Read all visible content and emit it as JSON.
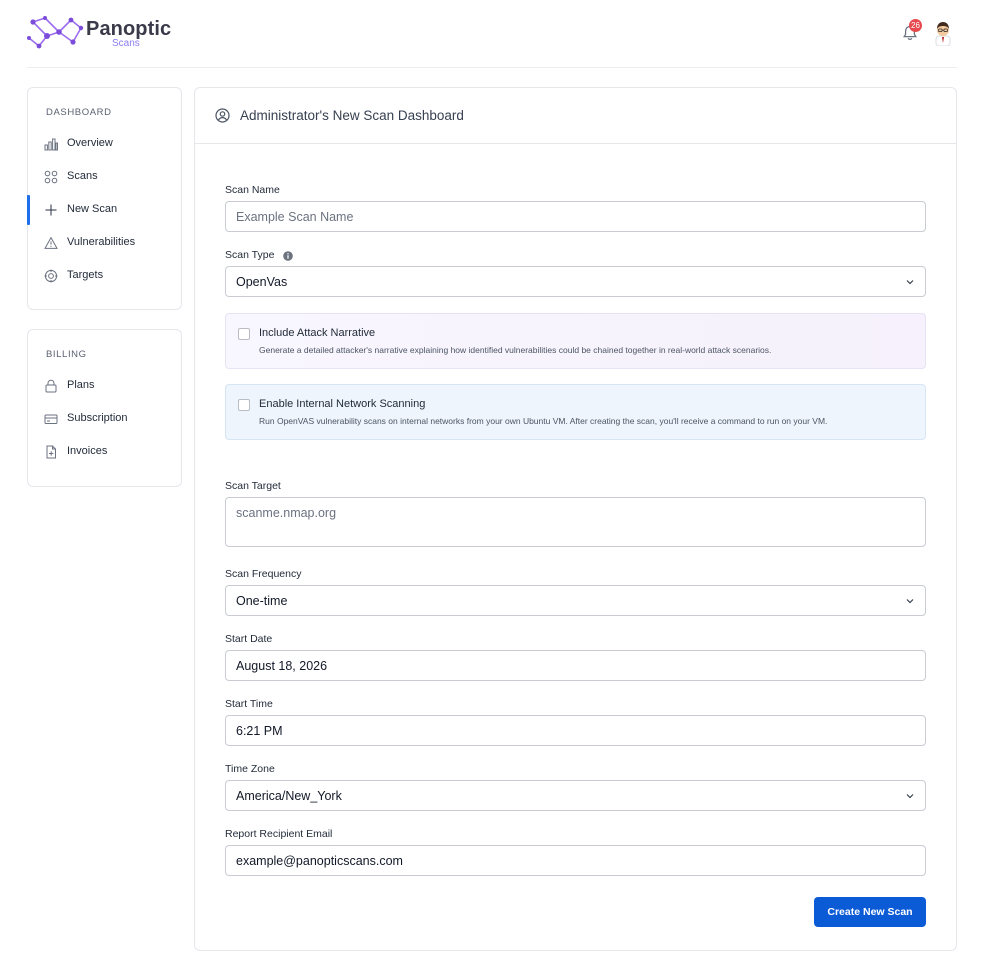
{
  "header": {
    "logo_text": "Panoptic",
    "logo_sub": "Scans",
    "notification_count": "26"
  },
  "sidebar": {
    "dashboard_heading": "DASHBOARD",
    "dashboard_items": [
      {
        "label": "Overview",
        "icon": "bar-chart-icon"
      },
      {
        "label": "Scans",
        "icon": "grid-icon"
      },
      {
        "label": "New Scan",
        "icon": "plus-icon",
        "active": true
      },
      {
        "label": "Vulnerabilities",
        "icon": "warning-icon"
      },
      {
        "label": "Targets",
        "icon": "crosshair-icon"
      }
    ],
    "billing_heading": "BILLING",
    "billing_items": [
      {
        "label": "Plans",
        "icon": "lock-icon"
      },
      {
        "label": "Subscription",
        "icon": "credit-card-icon"
      },
      {
        "label": "Invoices",
        "icon": "file-icon"
      }
    ]
  },
  "main": {
    "title": "Administrator's New Scan Dashboard",
    "scan_name": {
      "label": "Scan Name",
      "placeholder": "Example Scan Name",
      "value": ""
    },
    "scan_type": {
      "label": "Scan Type",
      "value": "OpenVas"
    },
    "attack_narrative": {
      "title": "Include Attack Narrative",
      "description": "Generate a detailed attacker's narrative explaining how identified vulnerabilities could be chained together in real-world attack scenarios."
    },
    "internal_network": {
      "title": "Enable Internal Network Scanning",
      "description": "Run OpenVAS vulnerability scans on internal networks from your own Ubuntu VM. After creating the scan, you'll receive a command to run on your VM."
    },
    "scan_target": {
      "label": "Scan Target",
      "placeholder": "scanme.nmap.org"
    },
    "scan_frequency": {
      "label": "Scan Frequency",
      "value": "One-time"
    },
    "start_date": {
      "label": "Start Date",
      "value": "August 18, 2026"
    },
    "start_time": {
      "label": "Start Time",
      "value": "6:21 PM"
    },
    "time_zone": {
      "label": "Time Zone",
      "value": "America/New_York"
    },
    "report_email": {
      "label": "Report Recipient Email",
      "value": "example@panopticscans.com"
    },
    "submit_label": "Create New Scan"
  },
  "colors": {
    "accent": "#0b5bd7",
    "active_indicator": "#1f6feb",
    "badge": "#e5484d",
    "logo_purple": "#8b5cf6"
  }
}
